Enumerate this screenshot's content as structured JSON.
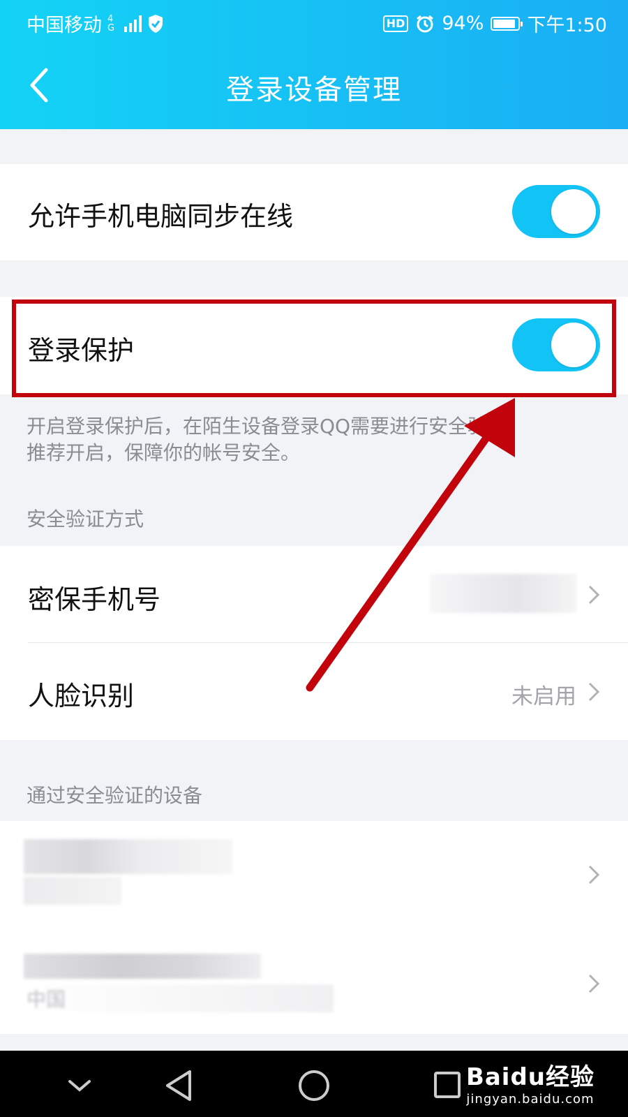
{
  "status_bar": {
    "carrier": "中国移动",
    "network": "4G",
    "battery": "94%",
    "time": "下午1:50"
  },
  "nav": {
    "title": "登录设备管理"
  },
  "sync": {
    "label": "允许手机电脑同步在线",
    "enabled": true
  },
  "protect": {
    "label": "登录保护",
    "enabled": true,
    "hint_line1": "开启登录保护后，在陌生设备登录QQ需要进行安全验证。",
    "hint_line2": "推荐开启，保障你的帐号安全。"
  },
  "verify": {
    "section_title": "安全验证方式",
    "phone_label": "密保手机号",
    "face_label": "人脸识别",
    "face_value": "未启用"
  },
  "devices": {
    "section_title": "通过安全验证的设备",
    "item2_sub": "中国"
  },
  "watermark": {
    "brand": "Baidu经验",
    "url": "jingyan.baidu.com"
  },
  "colors": {
    "accent": "#12c3f5",
    "annotation_red": "#c3030c"
  }
}
